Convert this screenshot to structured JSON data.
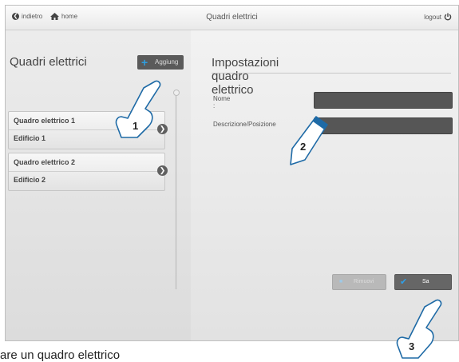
{
  "header": {
    "back_label": "indietro",
    "home_label": "home",
    "title": "Quadri elettrici",
    "logout_label": "logout"
  },
  "left_panel": {
    "title": "Quadri elettrici",
    "add_button_label": "Aggiung",
    "items": [
      {
        "name": "Quadro elettrico 1",
        "building": "Edificio 1"
      },
      {
        "name": "Quadro elettrico 2",
        "building": "Edificio 2"
      }
    ]
  },
  "right_panel": {
    "title": "Impostazioni quadro elettrico",
    "name_label": "Nome :",
    "name_value": "",
    "description_label": "Descrizione/Posizione",
    "description_value": "",
    "remove_label": "Rimuovi",
    "save_label": "Sa"
  },
  "callouts": [
    "1",
    "2",
    "3"
  ],
  "caption": "are un quadro elettrico",
  "colors": {
    "accent": "#2f9ee0",
    "input_bg": "#565656"
  },
  "icons": {
    "back": "back-arrow-circle-icon",
    "home": "home-icon",
    "logout": "power-icon",
    "add": "plus-icon",
    "item_arrow": "chevron-right-circle-icon",
    "remove": "remove-icon",
    "save": "checkmark-icon",
    "pointer": "hand-pointer-icon"
  }
}
